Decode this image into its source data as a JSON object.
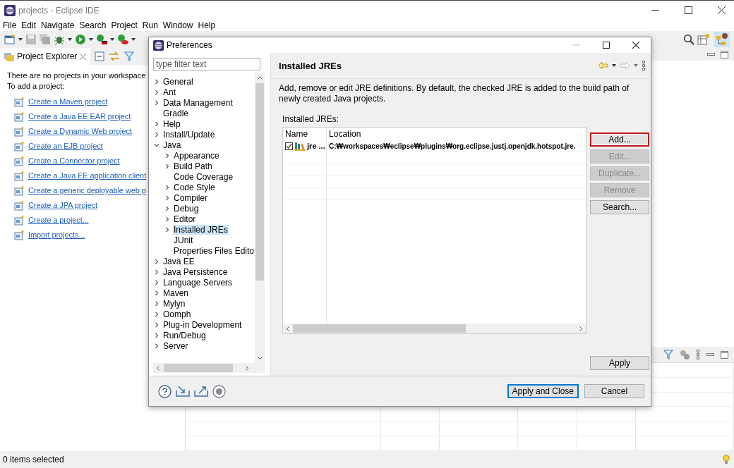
{
  "window": {
    "title": "projects - Eclipse IDE"
  },
  "menu": [
    "File",
    "Edit",
    "Navigate",
    "Search",
    "Project",
    "Run",
    "Window",
    "Help"
  ],
  "project_explorer": {
    "tab": "Project Explorer",
    "message": "There are no projects in your workspace",
    "prompt": "To add a project:",
    "links": [
      {
        "label": "Create a Maven project"
      },
      {
        "label": "Create a Java EE EAR project"
      },
      {
        "label": "Create a Dynamic Web project"
      },
      {
        "label": "Create an EJB project"
      },
      {
        "label": "Create a Connector project"
      },
      {
        "label": "Create a Java EE application client"
      },
      {
        "label": "Create a generic deployable web p"
      },
      {
        "label": "Create a JPA project"
      },
      {
        "label": "Create a project..."
      },
      {
        "label": "Import projects..."
      }
    ]
  },
  "status_bar": {
    "text": "0 items selected"
  },
  "dialog": {
    "title": "Preferences",
    "filter": {
      "placeholder": "type filter text"
    },
    "tree": [
      {
        "label": "General",
        "expandable": true,
        "expanded": false,
        "selected": false
      },
      {
        "label": "Ant",
        "expandable": true,
        "expanded": false,
        "selected": false
      },
      {
        "label": "Data Management",
        "expandable": true,
        "expanded": false,
        "selected": false
      },
      {
        "label": "Gradle",
        "expandable": false,
        "expanded": false,
        "selected": false
      },
      {
        "label": "Help",
        "expandable": true,
        "expanded": false,
        "selected": false
      },
      {
        "label": "Install/Update",
        "expandable": true,
        "expanded": false,
        "selected": false
      },
      {
        "label": "Java",
        "expandable": true,
        "expanded": true,
        "selected": false,
        "children": [
          {
            "label": "Appearance",
            "expandable": true,
            "expanded": false,
            "selected": false
          },
          {
            "label": "Build Path",
            "expandable": true,
            "expanded": false,
            "selected": false
          },
          {
            "label": "Code Coverage",
            "expandable": false,
            "expanded": false,
            "selected": false
          },
          {
            "label": "Code Style",
            "expandable": true,
            "expanded": false,
            "selected": false
          },
          {
            "label": "Compiler",
            "expandable": true,
            "expanded": false,
            "selected": false
          },
          {
            "label": "Debug",
            "expandable": true,
            "expanded": false,
            "selected": false
          },
          {
            "label": "Editor",
            "expandable": true,
            "expanded": false,
            "selected": false
          },
          {
            "label": "Installed JREs",
            "expandable": true,
            "expanded": false,
            "selected": true
          },
          {
            "label": "JUnit",
            "expandable": false,
            "expanded": false,
            "selected": false
          },
          {
            "label": "Properties Files Edito",
            "expandable": false,
            "expanded": false,
            "selected": false
          }
        ]
      },
      {
        "label": "Java EE",
        "expandable": true,
        "expanded": false,
        "selected": false
      },
      {
        "label": "Java Persistence",
        "expandable": true,
        "expanded": false,
        "selected": false
      },
      {
        "label": "Language Servers",
        "expandable": true,
        "expanded": false,
        "selected": false
      },
      {
        "label": "Maven",
        "expandable": true,
        "expanded": false,
        "selected": false
      },
      {
        "label": "Mylyn",
        "expandable": true,
        "expanded": false,
        "selected": false
      },
      {
        "label": "Oomph",
        "expandable": true,
        "expanded": false,
        "selected": false
      },
      {
        "label": "Plug-in Development",
        "expandable": true,
        "expanded": false,
        "selected": false
      },
      {
        "label": "Run/Debug",
        "expandable": true,
        "expanded": false,
        "selected": false
      },
      {
        "label": "Server",
        "expandable": true,
        "expanded": false,
        "selected": false
      }
    ],
    "page": {
      "title": "Installed JREs",
      "description": "Add, remove or edit JRE definitions. By default, the checked JRE is added to the build path of newly created Java projects.",
      "table_label": "Installed JREs:",
      "columns": [
        "Name",
        "Location"
      ],
      "rows": [
        {
          "checked": true,
          "name": "jre ...",
          "location": "C:₩workspaces₩eclipse₩plugins₩org.eclipse.justj.openjdk.hotspot.jre."
        }
      ],
      "buttons": [
        {
          "label": "Add...",
          "disabled": false,
          "highlighted": true
        },
        {
          "label": "Edit...",
          "disabled": true,
          "highlighted": false
        },
        {
          "label": "Duplicate...",
          "disabled": true,
          "highlighted": false
        },
        {
          "label": "Remove",
          "disabled": true,
          "highlighted": false
        },
        {
          "label": "Search...",
          "disabled": false,
          "highlighted": false
        }
      ],
      "apply": "Apply"
    },
    "footer_buttons": [
      {
        "label": "Apply and Close",
        "default": true
      },
      {
        "label": "Cancel",
        "default": false
      }
    ]
  }
}
